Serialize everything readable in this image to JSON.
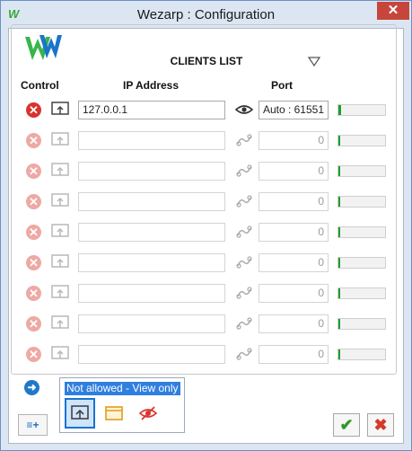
{
  "window": {
    "title": "Wezarp : Configuration",
    "close_label": "✕"
  },
  "clients_list": {
    "title": "CLIENTS LIST",
    "headers": {
      "control": "Control",
      "ip": "IP Address",
      "port": "Port"
    },
    "rows": [
      {
        "ip": "127.0.0.1",
        "port_mode": "Auto :",
        "port": "61551",
        "active": true,
        "status_level": 0.05
      },
      {
        "ip": "",
        "port_mode": "",
        "port": "0",
        "active": false,
        "status_level": 0.03
      },
      {
        "ip": "",
        "port_mode": "",
        "port": "0",
        "active": false,
        "status_level": 0.03
      },
      {
        "ip": "",
        "port_mode": "",
        "port": "0",
        "active": false,
        "status_level": 0.03
      },
      {
        "ip": "",
        "port_mode": "",
        "port": "0",
        "active": false,
        "status_level": 0.03
      },
      {
        "ip": "",
        "port_mode": "",
        "port": "0",
        "active": false,
        "status_level": 0.03
      },
      {
        "ip": "",
        "port_mode": "",
        "port": "0",
        "active": false,
        "status_level": 0.03
      },
      {
        "ip": "",
        "port_mode": "",
        "port": "0",
        "active": false,
        "status_level": 0.03
      },
      {
        "ip": "",
        "port_mode": "",
        "port": "0",
        "active": false,
        "status_level": 0.03
      }
    ]
  },
  "access_popup": {
    "label": "Not allowed - View only",
    "options": [
      "share-screen-icon",
      "window-icon",
      "hidden-eye-icon"
    ],
    "selected": 0
  },
  "footer": {
    "menu_add_label": "≡+",
    "ok_label": "✔",
    "cancel_label": "✖"
  },
  "colors": {
    "accent": "#2f7fe0",
    "delete_red": "#d8342d",
    "status_green": "#1e9e2e",
    "ok_green": "#2a9a2a"
  }
}
